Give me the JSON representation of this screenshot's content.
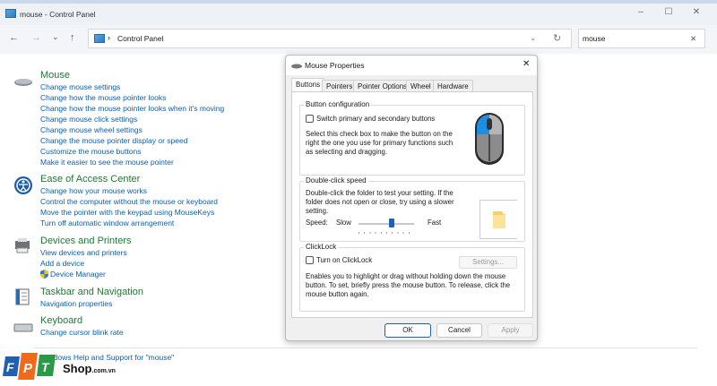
{
  "window": {
    "title": "mouse - Control Panel",
    "minimize": "–",
    "maximize": "☐",
    "close": "✕"
  },
  "nav": {
    "back": "←",
    "forward": "→",
    "recent": "⌄",
    "up": "↑",
    "breadcrumb_sep": "›",
    "breadcrumb": "Control Panel",
    "dropdown": "⌄",
    "refresh": "↻"
  },
  "search": {
    "value": "mouse",
    "clear": "✕"
  },
  "categories": [
    {
      "heading": "Mouse",
      "links": [
        "Change mouse settings",
        "Change how the mouse pointer looks",
        "Change how the mouse pointer looks when it's moving",
        "Change mouse click settings",
        "Change mouse wheel settings",
        "Change the mouse pointer display or speed",
        "Customize the mouse buttons",
        "Make it easier to see the mouse pointer"
      ]
    },
    {
      "heading": "Ease of Access Center",
      "links": [
        "Change how your mouse works",
        "Control the computer without the mouse or keyboard",
        "Move the pointer with the keypad using MouseKeys",
        "Turn off automatic window arrangement"
      ]
    },
    {
      "heading": "Devices and Printers",
      "links": [
        "View devices and printers",
        "Add a device",
        "Device Manager"
      ]
    },
    {
      "heading": "Taskbar and Navigation",
      "links": [
        "Navigation properties"
      ]
    },
    {
      "heading": "Keyboard",
      "links": [
        "Change cursor blink rate"
      ]
    }
  ],
  "help_link": "Windows Help and Support for \"mouse\"",
  "watermark": {
    "brand": "FPT",
    "text": "Shop",
    "suffix": ".com.vn"
  },
  "dialog": {
    "title": "Mouse Properties",
    "close": "✕",
    "tabs": [
      "Buttons",
      "Pointers",
      "Pointer Options",
      "Wheel",
      "Hardware"
    ],
    "active_tab": "Buttons",
    "button_config": {
      "legend": "Button configuration",
      "checkbox": "Switch primary and secondary buttons",
      "checked": false,
      "description": "Select this check box to make the button on the right the one you use for primary functions such as selecting and dragging."
    },
    "double_click": {
      "legend": "Double-click speed",
      "description": "Double-click the folder to test your setting. If the folder does not open or close, try using a slower setting.",
      "speed_label": "Speed:",
      "slow": "Slow",
      "fast": "Fast",
      "speed_fraction": 0.6
    },
    "clicklock": {
      "legend": "ClickLock",
      "checkbox": "Turn on ClickLock",
      "checked": false,
      "settings": "Settings...",
      "description": "Enables you to highlight or drag without holding down the mouse button. To set, briefly press the mouse button. To release, click the mouse button again."
    },
    "buttons": {
      "ok": "OK",
      "cancel": "Cancel",
      "apply": "Apply"
    }
  }
}
